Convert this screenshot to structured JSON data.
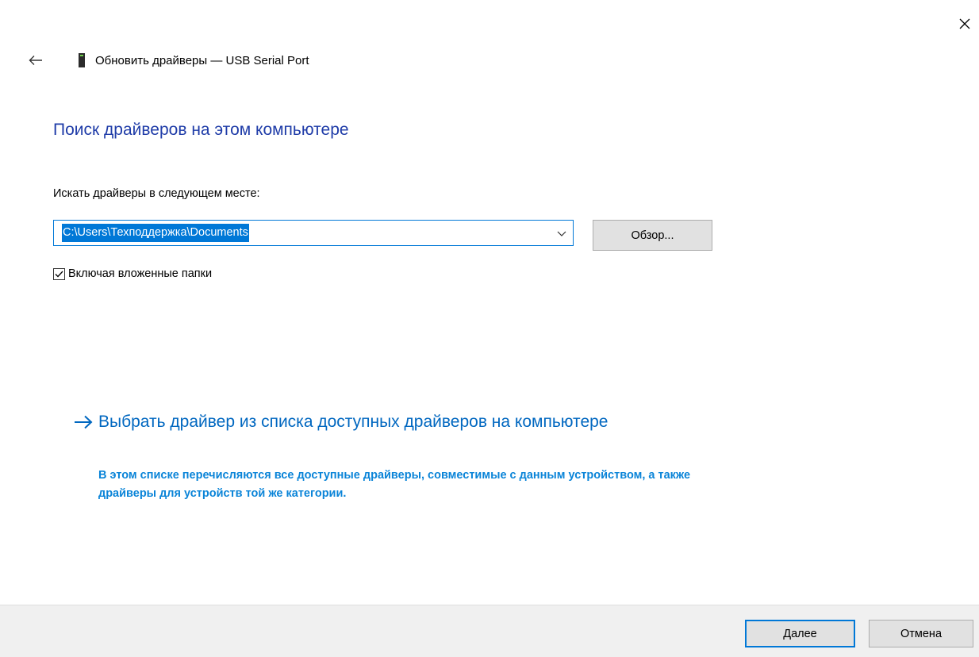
{
  "window": {
    "title": "Обновить драйверы — USB Serial Port",
    "close_icon": "close-icon",
    "back_icon": "back-arrow-icon",
    "device_icon": "usb-device-icon"
  },
  "main": {
    "heading": "Поиск драйверов на этом компьютере",
    "location_label": "Искать драйверы в следующем месте:",
    "location": {
      "value": "C:\\Users\\Техподдержка\\Documents",
      "dropdown_icon": "chevron-down-icon"
    },
    "browse_label": "Обзор...",
    "include_subfolders": {
      "label": "Включая вложенные папки",
      "checked": true
    },
    "pick_link": {
      "title": "Выбрать драйвер из списка доступных драйверов на компьютере",
      "description": "В этом списке перечисляются все доступные драйверы, совместимые с данным устройством, а также драйверы для устройств той же категории.",
      "icon": "arrow-right-icon"
    }
  },
  "footer": {
    "next_label": "Далее",
    "cancel_label": "Отмена"
  },
  "colors": {
    "heading": "#1f3ca8",
    "link": "#0067c0",
    "link_description": "#0a84d8",
    "accent": "#0078d7",
    "footer_bg": "#f0f0f0"
  }
}
